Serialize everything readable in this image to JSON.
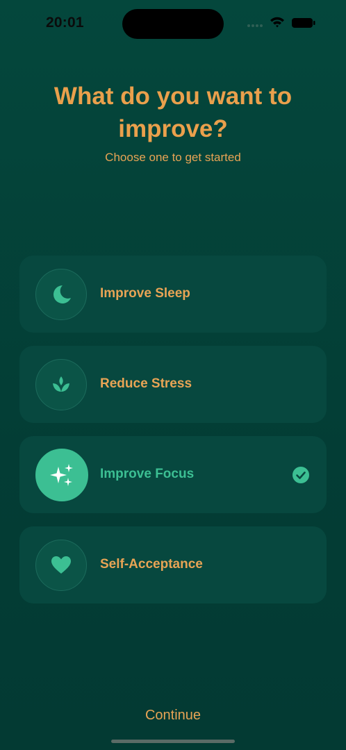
{
  "status_bar": {
    "time": "20:01",
    "icons": [
      "cellular-signal-icon",
      "wifi-icon",
      "battery-icon"
    ]
  },
  "header": {
    "title": "What do you want to improve?",
    "subtitle": "Choose one to get started"
  },
  "options": [
    {
      "label": "Improve Sleep",
      "icon": "moon-icon",
      "selected": false
    },
    {
      "label": "Reduce Stress",
      "icon": "lotus-icon",
      "selected": false
    },
    {
      "label": "Improve Focus",
      "icon": "sparkles-icon",
      "selected": true
    },
    {
      "label": "Self-Acceptance",
      "icon": "heart-icon",
      "selected": false
    }
  ],
  "footer": {
    "continue_label": "Continue"
  },
  "colors": {
    "background": "#04473c",
    "card": "#07483f",
    "accent_orange": "#eaa04c",
    "accent_green": "#3cbf93"
  }
}
